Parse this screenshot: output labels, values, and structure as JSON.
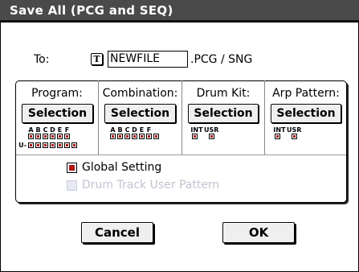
{
  "dialog": {
    "title": "Save All (PCG and SEQ)"
  },
  "to": {
    "label": "To:",
    "text_icon": "T",
    "value": "NEWFILE",
    "extension": ".PCG / SNG"
  },
  "columns": [
    {
      "header": "Program:",
      "button": "Selection",
      "bank_labels": [
        "A",
        "B",
        "C",
        "D",
        "E",
        "F"
      ],
      "rows": [
        {
          "prefix": "",
          "count": 6
        },
        {
          "prefix": "U-",
          "count": 7
        }
      ]
    },
    {
      "header": "Combination:",
      "button": "Selection",
      "bank_labels": [
        "A",
        "B",
        "C",
        "D",
        "E",
        "F"
      ],
      "rows": [
        {
          "prefix": "",
          "count": 7
        }
      ]
    },
    {
      "header": "Drum Kit:",
      "button": "Selection",
      "bank_labels": [
        "INT",
        "USR"
      ],
      "rows": [
        {
          "prefix": "",
          "count": 2
        }
      ]
    },
    {
      "header": "Arp Pattern:",
      "button": "Selection",
      "bank_labels": [
        "INT",
        "USR"
      ],
      "rows": [
        {
          "prefix": "",
          "count": 2
        }
      ]
    }
  ],
  "options": {
    "global_setting": {
      "label": "Global Setting",
      "checked": true
    },
    "drum_track": {
      "label": "Drum Track User Pattern",
      "checked": false,
      "disabled": true
    }
  },
  "buttons": {
    "cancel": "Cancel",
    "ok": "OK"
  },
  "colors": {
    "title_bg": "#4a4a4a",
    "check_red": "#b01515",
    "disabled_text": "#bfc3cf"
  }
}
